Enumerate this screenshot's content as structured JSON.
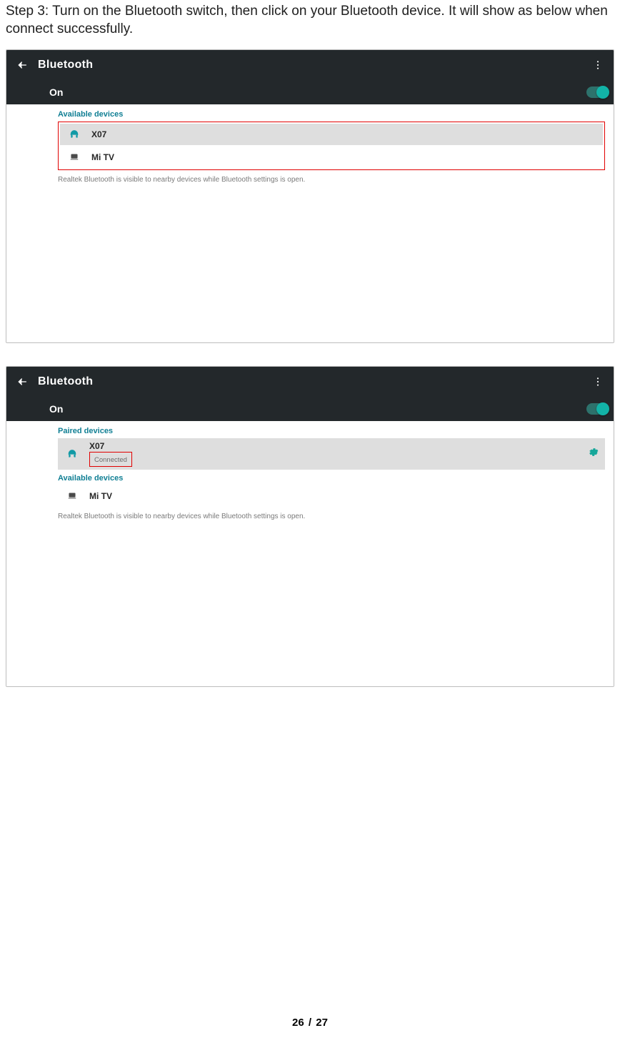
{
  "intro": "Step 3: Turn on the Bluetooth switch, then click on your Bluetooth device. It will show as below when connect successfully.",
  "screens": {
    "a": {
      "appbar_title": "Bluetooth",
      "on_label": "On",
      "sections": {
        "available": "Available devices"
      },
      "devices": {
        "x07": "X07",
        "mitv": "Mi TV"
      },
      "note": "Realtek Bluetooth is visible to nearby devices while Bluetooth settings is open."
    },
    "b": {
      "appbar_title": "Bluetooth",
      "on_label": "On",
      "sections": {
        "paired": "Paired devices",
        "available": "Available devices"
      },
      "devices": {
        "x07": {
          "name": "X07",
          "status": "Connected"
        },
        "mitv": "Mi TV"
      },
      "note": "Realtek Bluetooth is visible to nearby devices while Bluetooth settings is open."
    }
  },
  "footer": {
    "page": "26",
    "sep": "/",
    "total": "27"
  }
}
